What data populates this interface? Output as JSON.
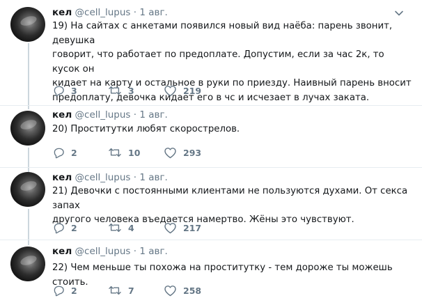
{
  "tweets": [
    {
      "name": "кел",
      "handle": "@cell_lupus",
      "dot": "·",
      "date": "1 авг.",
      "text_lines": [
        "19) На сайтах с анкетами появился новый вид наёба: парень звонит, девушка",
        "говорит, что работает по предоплате. Допустим, если за час 2к, то кусок он",
        "кидает на карту и остальное в руки по приезду. Наивный парень вносит",
        "предоплату, девочка кидает его в чс и исчезает в лучах заката."
      ],
      "replies": "3",
      "retweets": "3",
      "likes": "219"
    },
    {
      "name": "кел",
      "handle": "@cell_lupus",
      "dot": "·",
      "date": "1 авг.",
      "text_lines": [
        "20) Проститутки любят скорострелов."
      ],
      "replies": "2",
      "retweets": "10",
      "likes": "293"
    },
    {
      "name": "кел",
      "handle": "@cell_lupus",
      "dot": "·",
      "date": "1 авг.",
      "text_lines": [
        "21) Девочки с постоянными клиентами не пользуются духами. От секса запах",
        "другого человека въедается намертво. Жёны это чувствуют."
      ],
      "replies": "2",
      "retweets": "4",
      "likes": "217"
    },
    {
      "name": "кел",
      "handle": "@cell_lupus",
      "dot": "·",
      "date": "1 авг.",
      "text_lines": [
        "22) Чем меньше ты похожа на проститутку - тем дороже ты можешь стоить."
      ],
      "replies": "2",
      "retweets": "7",
      "likes": "258"
    }
  ],
  "icons": {
    "reply": "reply-icon",
    "retweet": "retweet-icon",
    "like": "like-icon",
    "caret": "chevron-down-icon"
  },
  "colors": {
    "text": "#14171a",
    "secondary": "#657786",
    "separator": "#e6ecf0",
    "thread_line": "#ccd6dd"
  }
}
